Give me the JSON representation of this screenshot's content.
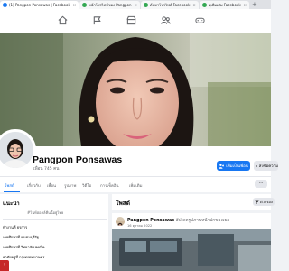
{
  "browser": {
    "tabs": [
      {
        "label": "(1) Pangpon Ponsawas | Facebook",
        "icon": "facebook-icon",
        "color": "#1877f2",
        "active": true
      },
      {
        "label": "หน้าโปรไฟล์ของ Pangpon",
        "icon": "page-icon",
        "color": "#34a853",
        "active": false
      },
      {
        "label": "ค้นหาโปรไฟล์ Facebook",
        "icon": "page-icon",
        "color": "#34a853",
        "active": false
      },
      {
        "label": "ดูเพิ่มเติม Facebook",
        "icon": "page-icon",
        "color": "#34a853",
        "active": false
      }
    ],
    "new_tab": "+"
  },
  "fb_nav": {
    "icons": [
      "home-icon",
      "flag-icon",
      "marketplace-icon",
      "groups-icon",
      "gaming-icon"
    ]
  },
  "profile": {
    "name": "Pangpon Ponsawas",
    "friends": "เพื่อน 745 คน",
    "add_friend_label": "เพิ่มเป็นเพื่อน",
    "message_label": "ส่งข้อความ"
  },
  "profile_tabs": {
    "items": [
      "โพสต์",
      "เกี่ยวกับ",
      "เพื่อน",
      "รูปภาพ",
      "วิดีโอ",
      "การเช็คอิน",
      "เพิ่มเติม"
    ],
    "more": "···"
  },
  "intro": {
    "title": "แนะนำ",
    "bio": "#ไนท์ฮอลล์คืนนี้อยู่ไทย",
    "lines": [
      "ทำงานที่ ธุรการ",
      "เคยศึกษาที่ ชุมชนบุรีรัฐ",
      "เคยศึกษาที่ วิทยาลัยเทคนิค",
      "อาศัยอยู่ที่ กรุงเทพมหานคร"
    ]
  },
  "posts": {
    "title": "โพสต์",
    "filter_label": "ตัวกรอง",
    "first": {
      "author": "Pangpon Ponsawas",
      "action": "อัปเดตรูปภาพหน้าปกของเธอ",
      "date": "16 ตุลาคม 2022"
    }
  },
  "corner_badge": "!"
}
